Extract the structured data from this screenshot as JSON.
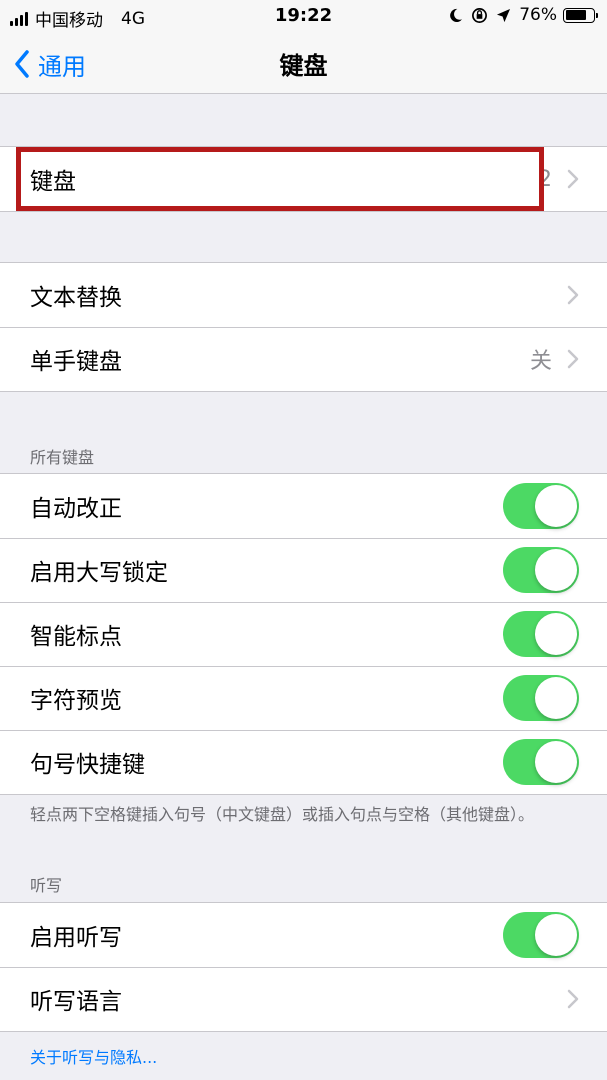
{
  "status_bar": {
    "carrier": "中国移动",
    "network": "4G",
    "time": "19:22",
    "battery": "76%",
    "battery_level": 0.76
  },
  "nav": {
    "back_label": "通用",
    "title": "键盘"
  },
  "group1": {
    "keyboards": {
      "label": "键盘",
      "value": "2"
    }
  },
  "group2": {
    "text_replacement": {
      "label": "文本替换"
    },
    "one_handed": {
      "label": "单手键盘",
      "value": "关"
    }
  },
  "all_keyboards": {
    "header": "所有键盘",
    "auto_correct": {
      "label": "自动改正",
      "on": true
    },
    "caps_lock": {
      "label": "启用大写锁定",
      "on": true
    },
    "smart_punct": {
      "label": "智能标点",
      "on": true
    },
    "char_preview": {
      "label": "字符预览",
      "on": true
    },
    "period_shortcut": {
      "label": "句号快捷键",
      "on": true
    },
    "footer": "轻点两下空格键插入句号（中文键盘）或插入句点与空格（其他键盘）。"
  },
  "dictation": {
    "header": "听写",
    "enable": {
      "label": "启用听写",
      "on": true
    },
    "languages": {
      "label": "听写语言"
    },
    "privacy_link": "关于听写与隐私..."
  },
  "colors": {
    "accent": "#007aff",
    "toggle_on": "#4cd964",
    "highlight": "#b51a1a"
  }
}
